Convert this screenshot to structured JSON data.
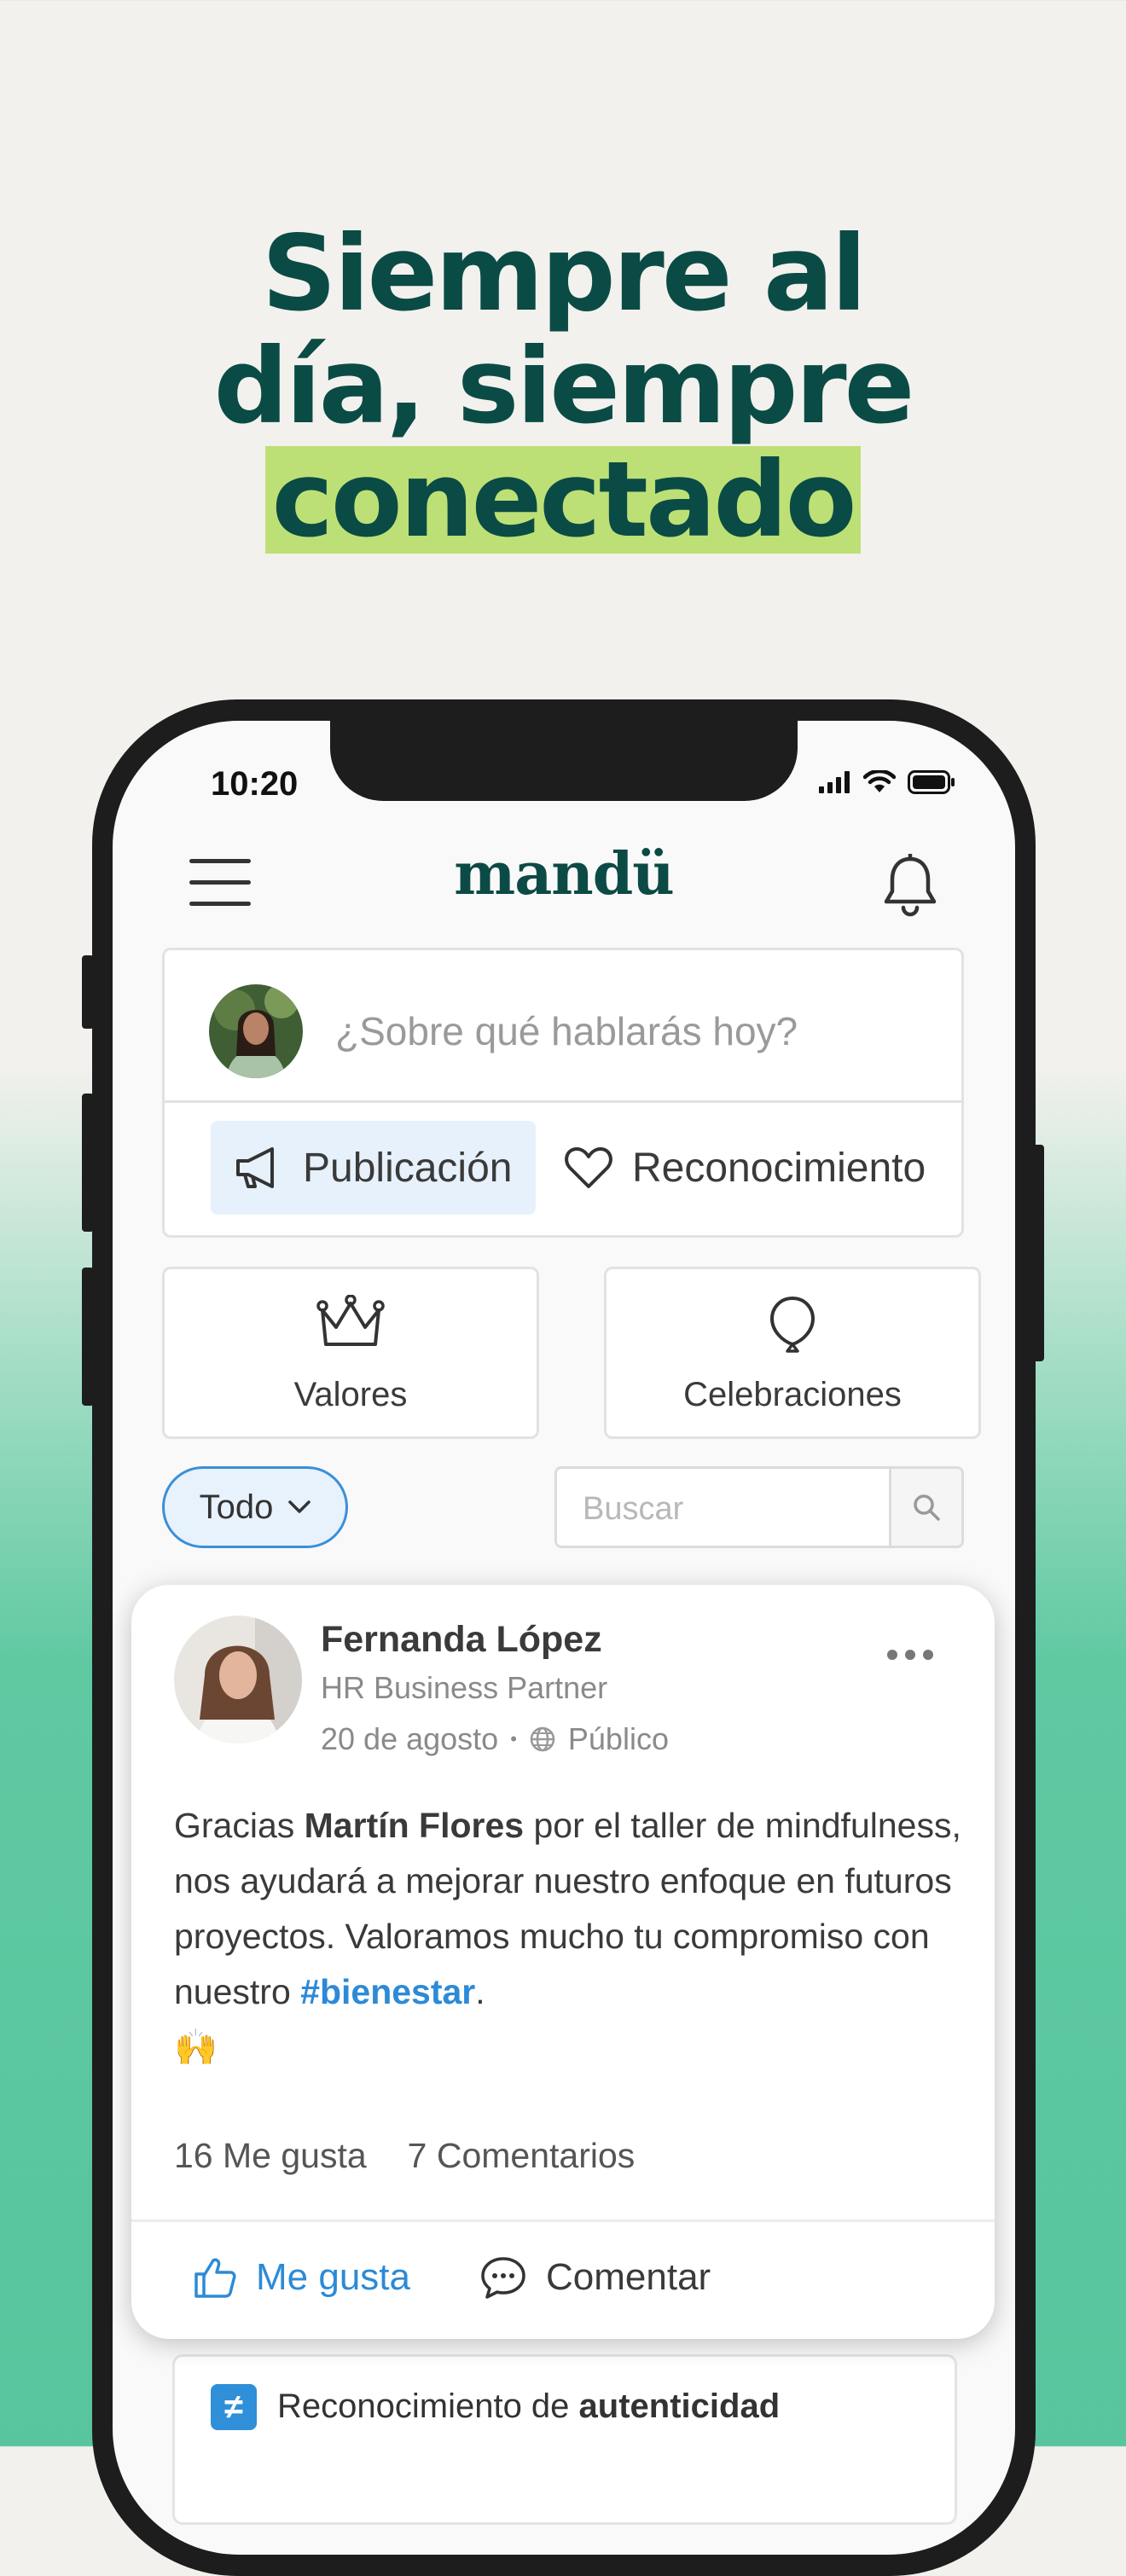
{
  "headline": {
    "line1": "Siempre al",
    "line2": "día, siempre",
    "highlight": "conectado"
  },
  "status_bar": {
    "time": "10:20"
  },
  "app": {
    "logo": "mandü"
  },
  "composer": {
    "placeholder": "¿Sobre qué hablarás hoy?",
    "publication_label": "Publicación",
    "recognition_label": "Reconocimiento"
  },
  "tiles": {
    "values_label": "Valores",
    "celebrations_label": "Celebraciones"
  },
  "filter": {
    "selected": "Todo"
  },
  "search": {
    "placeholder": "Buscar"
  },
  "post": {
    "author": "Fernanda López",
    "role": "HR Business Partner",
    "date": "20 de agosto",
    "separator": "•",
    "visibility": "Público",
    "body_1": "Gracias ",
    "mention": "Martín Flores",
    "body_2": " por el taller de mindfulness, nos ayudará a mejorar nuestro enfoque en futuros proyectos. Valoramos mucho tu compromiso con nuestro ",
    "hashtag": "#bienestar",
    "body_3": ".",
    "emoji": "🙌",
    "likes": "16 Me gusta",
    "comments": "7 Comentarios",
    "like_action": "Me gusta",
    "comment_action": "Comentar"
  },
  "next_card": {
    "prefix": "Reconocimiento de ",
    "value": "autenticidad",
    "badge": "≠"
  },
  "colors": {
    "headline": "#0b4b45",
    "highlight": "#bde076",
    "accent_blue": "#2d8ad6",
    "green_bg": "#58c59e"
  }
}
